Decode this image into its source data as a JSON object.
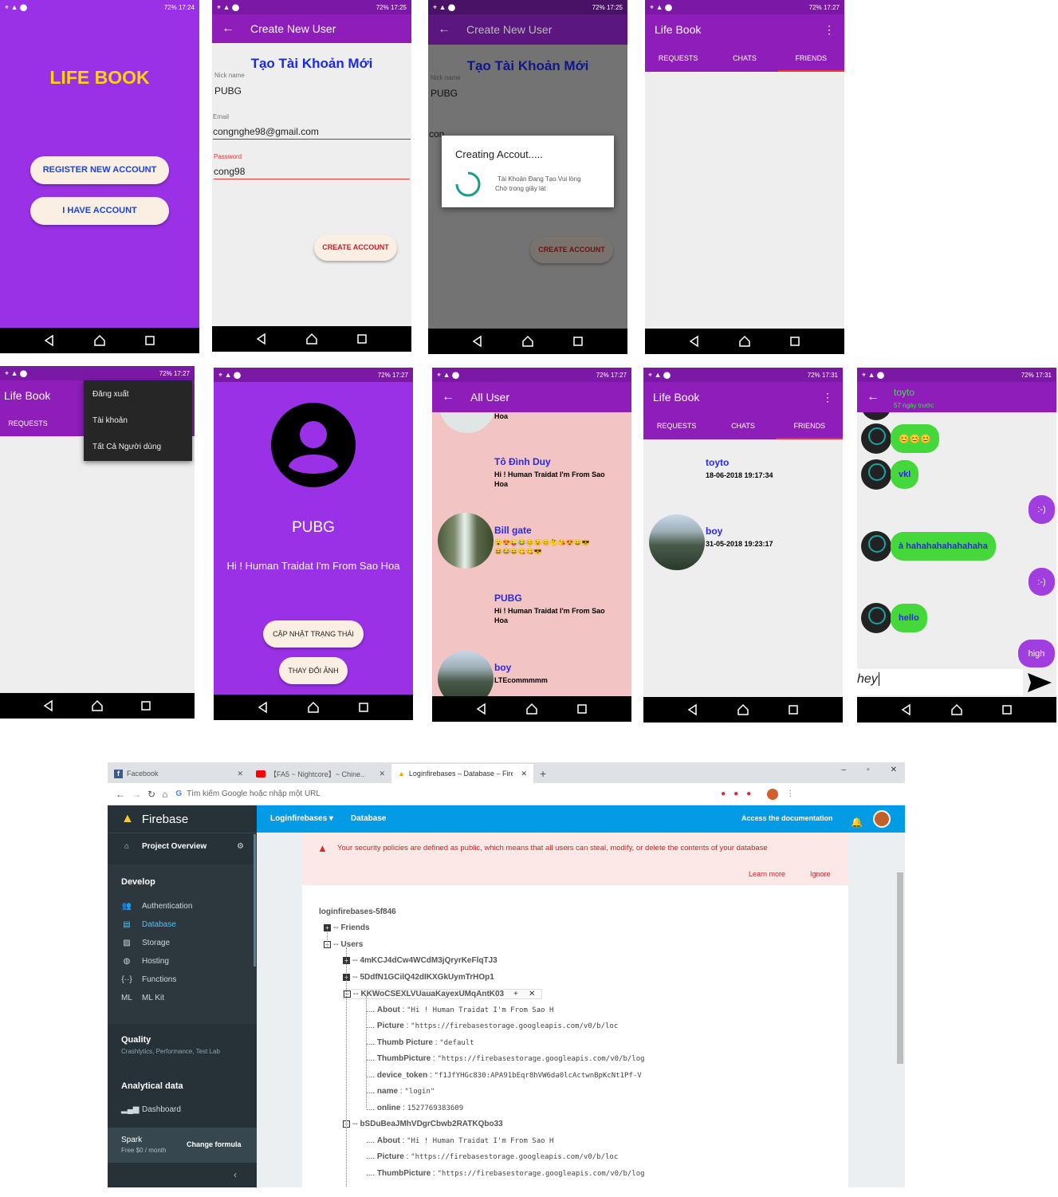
{
  "status": {
    "s1_time": "17:24",
    "s2_time": "17:25",
    "s3_time": "17:25",
    "s4_time": "17:27",
    "s5_time": "17:27",
    "s6_time": "17:27",
    "s7_time": "17:27",
    "s8_time": "17:31",
    "s9_time": "17:31",
    "battery": "72%"
  },
  "screen1": {
    "title": "LIFE BOOK",
    "register_btn": "REGISTER NEW ACCOUNT",
    "have_account_btn": "I HAVE ACCOUNT"
  },
  "screen2": {
    "toolbar_title": "Create New User",
    "heading": "Tạo Tài Khoản Mới",
    "nick_label": "Nick name",
    "nick_value": "PUBG",
    "email_label": "Email",
    "email_value": "congnghe98@gmail.com",
    "password_label": "Password",
    "password_value": "cong98",
    "create_btn": "CREATE ACCOUNT"
  },
  "screen3": {
    "toolbar_title": "Create New User",
    "heading": "Tạo Tài Khoản Mới",
    "nick_label": "Nick name",
    "nick_value": "PUBG",
    "email_value": "congnghe98@gmail.com",
    "create_btn": "CREATE ACCOUNT",
    "dialog_title": "Creating Accout.....",
    "dialog_msg_1": "Tài Khoản Đang Tạo Vui lòng",
    "dialog_msg_2": "Chờ trong giây lát"
  },
  "screen4": {
    "toolbar_title": "Life Book",
    "tabs": [
      "REQUESTS",
      "CHATS",
      "FRIENDS"
    ]
  },
  "screen5": {
    "toolbar_title": "Life Book",
    "tab_requests": "REQUESTS",
    "menu": [
      "Đăng xuất",
      "Tài khoản",
      "Tất Cả Người dùng"
    ]
  },
  "screen6": {
    "name": "PUBG",
    "status": "Hi ! Human Traidat I'm From Sao Hoa",
    "update_btn": "CẬP NHẬT TRẠNG THÁI",
    "change_btn": "THAY ĐỔI ẢNH"
  },
  "screen7": {
    "toolbar_title": "All User",
    "top_partial": "Hoa",
    "users": [
      {
        "name": "Tô Đình Duy",
        "status_1": "Hi ! Human Traidat I'm From Sao",
        "status_2": "Hoa"
      },
      {
        "name": "Bill gate",
        "status_1": "😮😍😜😂😊😉😊🤔😘😍😀😎",
        "status_2": "😆😂😄😋😋😎"
      },
      {
        "name": "PUBG",
        "status_1": "Hi ! Human Traidat I'm From Sao",
        "status_2": "Hoa"
      },
      {
        "name": "boy",
        "status_1": "LTEcommmmm",
        "status_2": ""
      }
    ]
  },
  "screen8": {
    "toolbar_title": "Life Book",
    "tabs": [
      "REQUESTS",
      "CHATS",
      "FRIENDS"
    ],
    "friends": [
      {
        "name": "toyto",
        "date": "18-06-2018 19:17:34"
      },
      {
        "name": "boy",
        "date": "31-05-2018 19:23:17"
      }
    ]
  },
  "screen9": {
    "title": "toyto",
    "subtitle": "57 ngày trước",
    "messages": [
      "😊😊😊",
      "vkl",
      ":-)",
      "à hahahahahahahaha",
      ":-)",
      "hello",
      "high"
    ],
    "input_value": "hey"
  },
  "browser": {
    "tabs": [
      "Facebook",
      "【FA5 ~ Nightcore】~ Chine...",
      "Loginfirebases – Database – Fireb..."
    ],
    "address_placeholder": "Tìm kiếm Google hoặc nhập một URL",
    "brand": "Firebase",
    "project_overview": "Project Overview",
    "develop": "Develop",
    "develop_items": [
      "Authentication",
      "Database",
      "Storage",
      "Hosting",
      "Functions",
      "ML Kit"
    ],
    "quality": "Quality",
    "quality_sub": "Crashlytics, Performance, Test Lab",
    "analytics": "Analytical data",
    "dashboard": "Dashboard",
    "plan": "Spark",
    "plan_price": "Free $0 / month",
    "change_formula": "Change formula",
    "project_select": "Loginfirebases",
    "section": "Database",
    "docs_link": "Access the documentation",
    "warning": "Your security policies are defined as public, which means that all users can steal, modify, or delete the contents of your database",
    "learn_more": "Learn more",
    "ignore": "Ignore",
    "root": "loginfirebases-5f846",
    "friends_node": "Friends",
    "users_node": "Users",
    "uid1": "4mKCJ4dCw4WCdM3jQryrKeFlqTJ3",
    "uid2": "5DdfN1GCilQ42dIKXGkUymTrHOp1",
    "uid3": "KKWoCSEXLVUauaKayexUMqAntK03",
    "uid4": "bSDuBeaJMhVDgrCbwb2RATKQbo33",
    "fields1": [
      {
        "k": "About",
        "v": "\"Hi ! Human Traidat I'm From Sao H"
      },
      {
        "k": "Picture",
        "v": "\"https://firebasestorage.googleapis.com/v0/b/loc"
      },
      {
        "k": "Thumb Picture",
        "v": "\"default"
      },
      {
        "k": "ThumbPicture",
        "v": "\"https://firebasestorage.googleapis.com/v0/b/log"
      },
      {
        "k": "device_token",
        "v": "\"f1JfYHGc830:APA91bEqr8hVW6da0lcActwnBpKcNt1Pf-V"
      },
      {
        "k": "name",
        "v": "\"login\""
      },
      {
        "k": "online",
        "v": "1527769383609"
      }
    ],
    "fields2": [
      {
        "k": "About",
        "v": "\"Hi ! Human Traidat I'm From Sao H"
      },
      {
        "k": "Picture",
        "v": "\"https://firebasestorage.googleapis.com/v0/b/loc"
      },
      {
        "k": "ThumbPicture",
        "v": "\"https://firebasestorage.googleapis.com/v0/b/log"
      }
    ]
  }
}
